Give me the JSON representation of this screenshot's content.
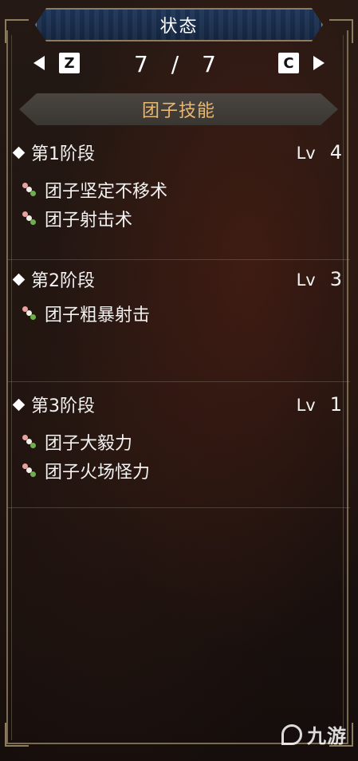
{
  "header": {
    "title": "状态"
  },
  "pager": {
    "left_key": "Z",
    "right_key": "C",
    "current": "7",
    "separator": "/",
    "total": "7"
  },
  "section": {
    "title": "团子技能"
  },
  "stages": [
    {
      "label": "第1阶段",
      "lv_label": "Lv",
      "lv": "4",
      "skills": [
        "团子坚定不移术",
        "团子射击术"
      ]
    },
    {
      "label": "第2阶段",
      "lv_label": "Lv",
      "lv": "3",
      "skills": [
        "团子粗暴射击"
      ]
    },
    {
      "label": "第3阶段",
      "lv_label": "Lv",
      "lv": "1",
      "skills": [
        "团子大毅力",
        "团子火场怪力"
      ]
    }
  ],
  "watermark": {
    "text": "九游"
  },
  "colors": {
    "title_bar": "#1d3458",
    "section_text": "#e6b873",
    "frame": "#8d7c5e"
  },
  "icons": {
    "skill": "dango-icon",
    "stage": "diamond-bullet-icon"
  }
}
